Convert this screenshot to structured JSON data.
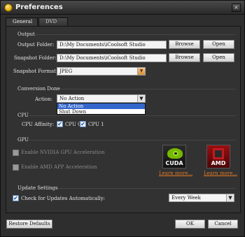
{
  "window": {
    "title": "Preferences",
    "close_glyph": "×"
  },
  "tabs": [
    {
      "label": "General",
      "active": true
    },
    {
      "label": "DVD",
      "active": false
    }
  ],
  "output": {
    "section_label": "Output",
    "output_folder_label": "Output Folder:",
    "output_folder_value": "D:\\My Documents\\iCoolsoft Studio",
    "snapshot_folder_label": "Snapshot Folder:",
    "snapshot_folder_value": "D:\\My Documents\\iCoolsoft Studio",
    "browse_label": "Browse",
    "open_label": "Open",
    "snapshot_format_label": "Snapshot Format:",
    "snapshot_format_value": "JPEG"
  },
  "conversion_done": {
    "section_label": "Conversion Done",
    "action_label": "Action:",
    "action_value": "No Action",
    "options": [
      "No Action",
      "Shut Down"
    ]
  },
  "cpu": {
    "section_label": "CPU",
    "affinity_label": "CPU Affinity:",
    "cpu0_label": "CPU 0",
    "cpu1_label": "CPU 1",
    "cpu0_checked": true,
    "cpu1_checked": true
  },
  "gpu": {
    "section_label": "GPU",
    "nvidia_label": "Enable NVIDIA GPU Acceleration",
    "amd_label": "Enable AMD APP Acceleration",
    "nvidia_logo_text": "CUDA",
    "amd_logo_text": "AMD",
    "learn_more_label": "Learn more..."
  },
  "update_settings": {
    "section_label": "Update Settings",
    "check_label": "Check for Updates Automatically:",
    "check_enabled": true,
    "frequency_value": "Every Week"
  },
  "footer": {
    "restore_label": "Restore Defaults",
    "ok_label": "OK",
    "cancel_label": "Cancel"
  },
  "icons": {
    "checkmark": "✔",
    "dropdown_arrow": "▼"
  },
  "colors": {
    "accent_orange": "#e07a24",
    "selection_blue": "#3366cc",
    "nvidia_green": "#76b900",
    "amd_red": "#c01a1f"
  }
}
